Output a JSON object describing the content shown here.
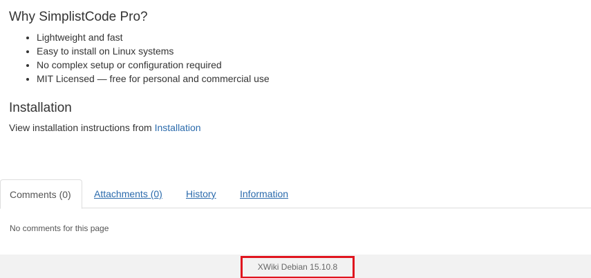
{
  "why_section": {
    "heading": "Why SimplistCode Pro?",
    "features": [
      "Lightweight and fast",
      "Easy to install on Linux systems",
      "No complex setup or configuration required",
      "MIT Licensed — free for personal and commercial use"
    ]
  },
  "installation_section": {
    "heading": "Installation",
    "text": "View installation instructions from ",
    "link_label": "Installation"
  },
  "tabs": {
    "comments": "Comments (0)",
    "attachments": "Attachments (0)",
    "history": "History",
    "information": "Information"
  },
  "comments_panel": {
    "empty_text": "No comments for this page"
  },
  "footer": {
    "version": "XWiki Debian 15.10.8",
    "highlight_color": "#e0141e"
  }
}
